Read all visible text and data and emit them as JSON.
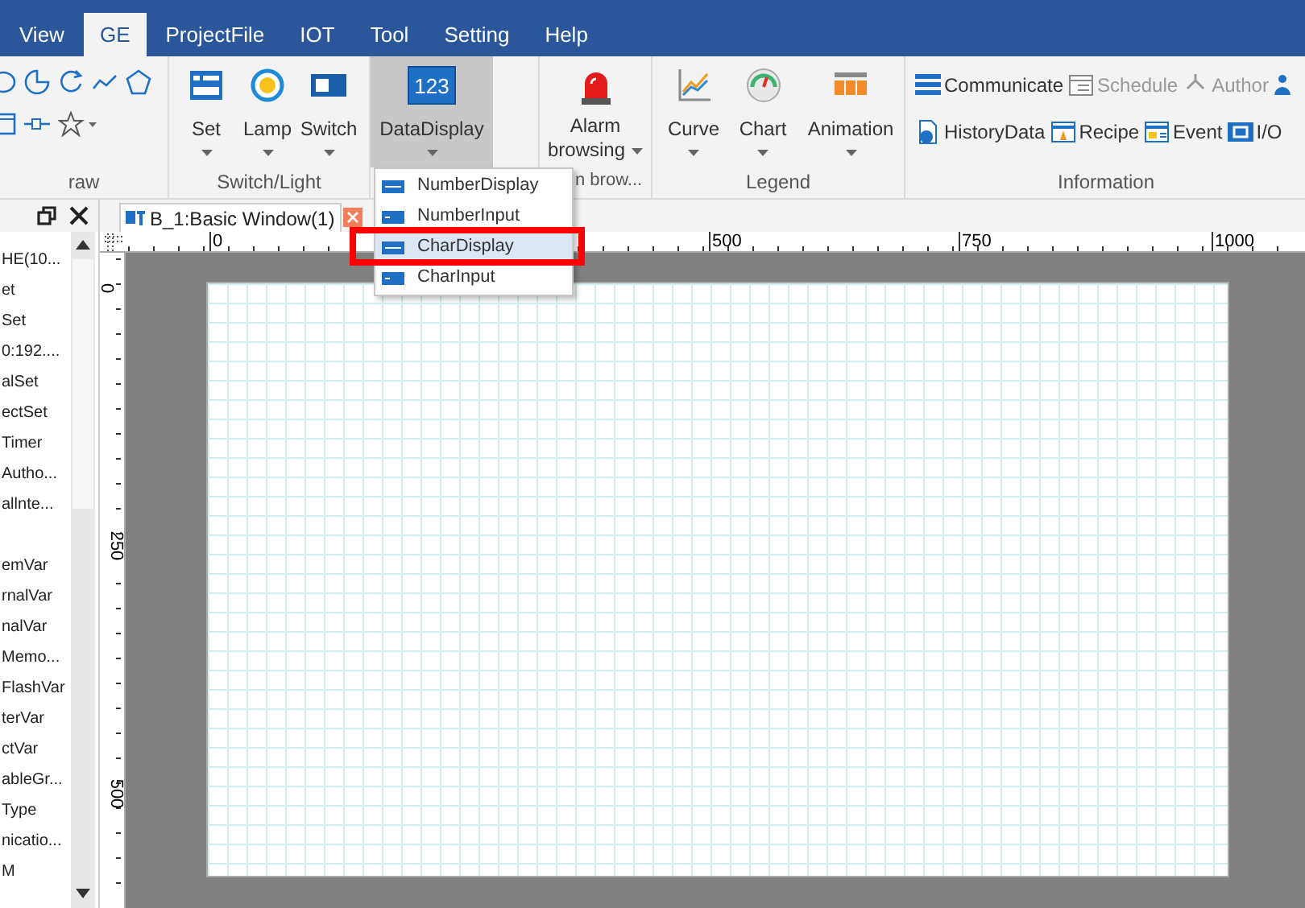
{
  "menu_tabs": [
    {
      "label": "View",
      "selected": false
    },
    {
      "label": "GE",
      "selected": true
    },
    {
      "label": "ProjectFile",
      "selected": false
    },
    {
      "label": "IOT",
      "selected": false
    },
    {
      "label": "Tool",
      "selected": false
    },
    {
      "label": "Setting",
      "selected": false
    },
    {
      "label": "Help",
      "selected": false
    }
  ],
  "ribbon": {
    "draw_group": {
      "label": "raw"
    },
    "switch_light_group": {
      "label": "Switch/Light",
      "buttons": [
        {
          "label": "Set",
          "dropdown": true,
          "selected": false
        },
        {
          "label": "Lamp",
          "dropdown": true,
          "selected": false
        },
        {
          "label": "Switch",
          "dropdown": true,
          "selected": false
        }
      ]
    },
    "data_display_group": {
      "buttons": [
        {
          "label": "DataDisplay",
          "icon_text": "123",
          "dropdown": true,
          "selected": true
        }
      ]
    },
    "alarm_group": {
      "label": "n brow...",
      "buttons": [
        {
          "label": "Alarm browsing",
          "dropdown": true,
          "selected": false
        }
      ]
    },
    "legend_group": {
      "label": "Legend",
      "buttons": [
        {
          "label": "Curve",
          "dropdown": true,
          "selected": false
        },
        {
          "label": "Chart",
          "dropdown": true,
          "selected": false
        },
        {
          "label": "Animation",
          "dropdown": true,
          "selected": false
        }
      ]
    },
    "information_group": {
      "label": "Information",
      "rows": [
        [
          {
            "label": "Communicate",
            "disabled": false
          },
          {
            "label": "Schedule",
            "disabled": true
          },
          {
            "label": "Author",
            "disabled": true
          }
        ],
        [
          {
            "label": "HistoryData",
            "disabled": false
          },
          {
            "label": "Recipe",
            "disabled": false
          },
          {
            "label": "Event",
            "disabled": false
          },
          {
            "label": "I/O",
            "disabled": false
          }
        ]
      ]
    }
  },
  "dropdown_menu": {
    "items": [
      {
        "label": "NumberDisplay",
        "selected": false,
        "annotated": false
      },
      {
        "label": "NumberInput",
        "selected": false,
        "annotated": false
      },
      {
        "label": "CharDisplay",
        "selected": true,
        "annotated": true
      },
      {
        "label": "CharInput",
        "selected": false,
        "annotated": false
      }
    ]
  },
  "left_panel": {
    "items": [
      "HE(10...",
      "et",
      "Set",
      "0:192....",
      "alSet",
      "ectSet",
      "Timer",
      "Autho...",
      "allnte...",
      "emVar",
      "rnalVar",
      "nalVar",
      "Memo...",
      "FlashVar",
      "terVar",
      "ctVar",
      "ableGr...",
      "Type",
      "nicatio...",
      "M"
    ]
  },
  "document_tab": {
    "title": "B_1:Basic Window(1)",
    "selected": true
  },
  "ruler": {
    "x_labels": [
      "0",
      "500",
      "750",
      "1000"
    ],
    "y_labels": [
      "0",
      "250",
      "500"
    ]
  }
}
